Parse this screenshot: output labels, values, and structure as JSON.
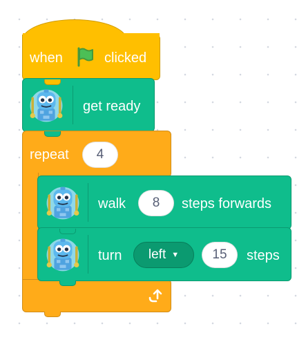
{
  "hat_block": {
    "when": "when",
    "clicked": "clicked",
    "flag_icon": "green-flag-icon"
  },
  "get_ready_block": {
    "label": "get ready",
    "icon": "robot-sprite-icon"
  },
  "repeat_block": {
    "label": "repeat",
    "count": "4",
    "loop_icon": "loop-arrow-icon"
  },
  "walk_block": {
    "walk": "walk",
    "steps": "8",
    "suffix": "steps forwards",
    "icon": "robot-sprite-icon"
  },
  "turn_block": {
    "turn": "turn",
    "direction": "left",
    "amount": "15",
    "suffix": "steps",
    "icon": "robot-sprite-icon"
  },
  "colors": {
    "events": "#ffbf00",
    "control": "#ffab19",
    "motion_extension": "#0fbd8c",
    "text": "#575e75"
  }
}
